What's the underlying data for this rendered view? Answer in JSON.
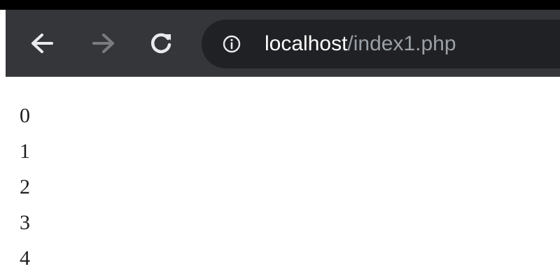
{
  "browser": {
    "address_bar": {
      "host": "localhost",
      "path": "/index1.php"
    },
    "icons": {
      "back": "arrow-left-icon",
      "forward": "arrow-right-icon",
      "reload": "reload-icon",
      "site_info": "info-circle-icon"
    },
    "colors": {
      "toolbar": "#35363a",
      "omnibox": "#202124",
      "host_text": "#ffffff",
      "path_text": "#9aa0a6",
      "forward_disabled": "#7a7b7f"
    }
  },
  "page": {
    "lines": [
      "0",
      "1",
      "2",
      "3",
      "4"
    ]
  }
}
